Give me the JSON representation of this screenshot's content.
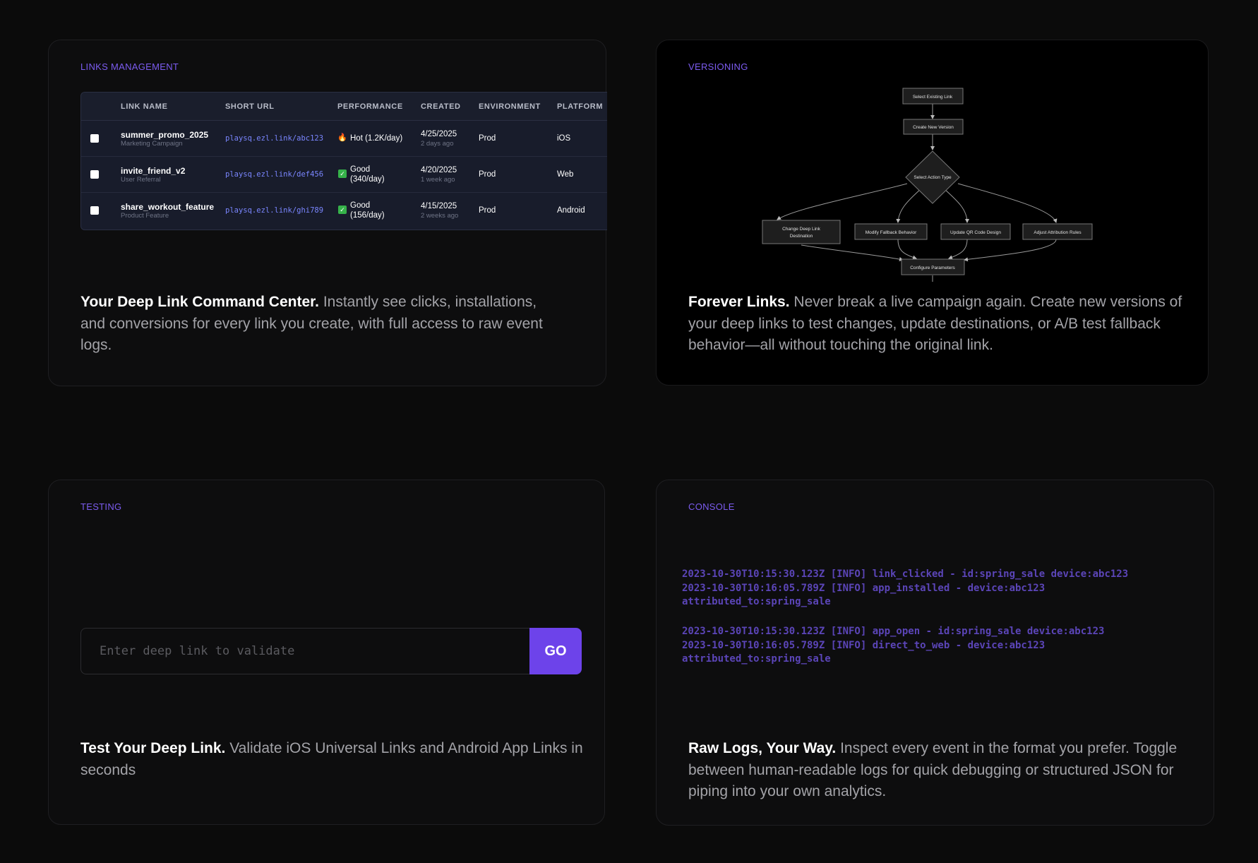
{
  "links": {
    "label": "LINKS MANAGEMENT",
    "columns": [
      "LINK NAME",
      "SHORT URL",
      "PERFORMANCE",
      "CREATED",
      "ENVIRONMENT",
      "PLATFORM"
    ],
    "rows": [
      {
        "name": "summer_promo_2025",
        "sub": "Marketing Campaign",
        "url": "playsq.ezl.link/abc123",
        "perf_icon": "fire-icon",
        "perf_line1": "Hot (1.2K/day)",
        "perf_line2": "",
        "created": "4/25/2025",
        "created_rel": "2 days ago",
        "env": "Prod",
        "platform": "iOS"
      },
      {
        "name": "invite_friend_v2",
        "sub": "User Referral",
        "url": "playsq.ezl.link/def456",
        "perf_icon": "check-icon",
        "perf_line1": "Good",
        "perf_line2": "(340/day)",
        "created": "4/20/2025",
        "created_rel": "1 week ago",
        "env": "Prod",
        "platform": "Web"
      },
      {
        "name": "share_workout_feature",
        "sub": "Product Feature",
        "url": "playsq.ezl.link/ghi789",
        "perf_icon": "check-icon",
        "perf_line1": "Good",
        "perf_line2": "(156/day)",
        "created": "4/15/2025",
        "created_rel": "2 weeks ago",
        "env": "Prod",
        "platform": "Android"
      }
    ],
    "desc_title": "Your Deep Link Command Center.",
    "desc_body": " Instantly see clicks, installations, and conversions for every link you create, with full access to raw event logs."
  },
  "versioning": {
    "label": "VERSIONING",
    "nodes": {
      "select_existing": "Select Existing Link",
      "create_new": "Create New Version",
      "select_action": "Select Action Type",
      "change_dest_1": "Change Deep Link",
      "change_dest_2": "Destination",
      "modify_fallback": "Modify Fallback Behavior",
      "update_qr": "Update QR Code Design",
      "adjust_attr": "Adjust Attribution Rules",
      "configure": "Configure Parameters"
    },
    "desc_title": "Forever Links.",
    "desc_body": " Never break a live campaign again. Create new versions of your deep links to test changes, update destinations, or A/B test fallback behavior—all without touching the original link."
  },
  "testing": {
    "label": "TESTING",
    "placeholder": "Enter deep link to validate",
    "go_label": "GO",
    "desc_title": "Test Your Deep Link.",
    "desc_body": " Validate iOS Universal Links and Android App Links in seconds"
  },
  "console": {
    "label": "CONSOLE",
    "group1": [
      "2023-10-30T10:15:30.123Z [INFO] link_clicked - id:spring_sale device:abc123",
      "2023-10-30T10:16:05.789Z [INFO] app_installed - device:abc123",
      "attributed_to:spring_sale"
    ],
    "group2": [
      "2023-10-30T10:15:30.123Z [INFO] app_open - id:spring_sale device:abc123",
      "2023-10-30T10:16:05.789Z [INFO] direct_to_web - device:abc123",
      "attributed_to:spring_sale"
    ],
    "desc_title": "Raw Logs, Your Way.",
    "desc_body": "  Inspect every event in the format you prefer. Toggle between human-readable logs for quick debugging or structured JSON for piping into your own analytics."
  },
  "colors": {
    "accent": "#6d43ea",
    "label": "#7c5cf0",
    "link": "#7a86ff",
    "log": "#5b45b8"
  }
}
